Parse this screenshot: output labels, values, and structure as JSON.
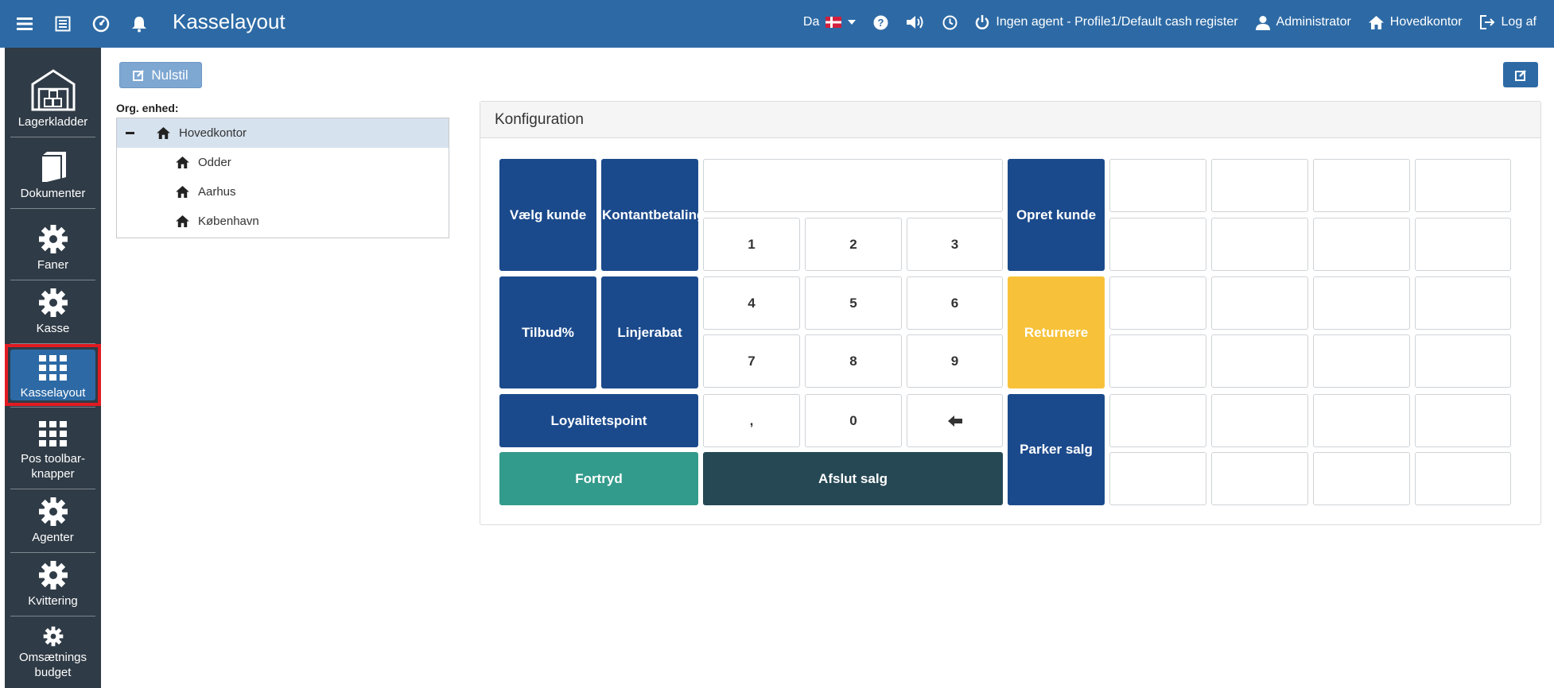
{
  "header": {
    "title": "Kasselayout",
    "language": "Da",
    "agent_label": "Ingen agent - Profile1/Default cash register",
    "user_label": "Administrator",
    "office_label": "Hovedkontor",
    "logout_label": "Log af"
  },
  "sidebar": {
    "items": [
      {
        "label": "Lagerkladder",
        "icon": "warehouse-icon"
      },
      {
        "label": "Dokumenter",
        "icon": "book-icon"
      },
      {
        "label": "Faner",
        "icon": "gear-icon"
      },
      {
        "label": "Kasse",
        "icon": "gear-icon"
      },
      {
        "label": "Kasselayout",
        "icon": "grid-icon",
        "active": true
      },
      {
        "label": "Pos toolbar-knapper",
        "icon": "grid-icon"
      },
      {
        "label": "Agenter",
        "icon": "gear-icon"
      },
      {
        "label": "Kvittering",
        "icon": "gear-icon"
      },
      {
        "label": "Omsætnings budget",
        "icon": "gear-icon"
      }
    ]
  },
  "toolbar": {
    "reset_label": "Nulstil"
  },
  "org": {
    "label": "Org. enhed:",
    "tree": [
      {
        "label": "Hovedkontor",
        "level": 0
      },
      {
        "label": "Odder",
        "level": 1
      },
      {
        "label": "Aarhus",
        "level": 1
      },
      {
        "label": "København",
        "level": 1
      }
    ]
  },
  "config": {
    "title": "Konfiguration",
    "keys": {
      "choose_customer": "Vælg kunde",
      "cash_payment": "Kontantbetaling",
      "create_customer": "Opret kunde",
      "offer_pct": "Tilbud%",
      "line_discount": "Linjerabat",
      "return": "Returnere",
      "loyalty": "Loyalitetspoint",
      "park_sale": "Parker salg",
      "undo": "Fortryd",
      "finish_sale": "Afslut salg",
      "n1": "1",
      "n2": "2",
      "n3": "3",
      "n4": "4",
      "n5": "5",
      "n6": "6",
      "n7": "7",
      "n8": "8",
      "n9": "9",
      "comma": ",",
      "n0": "0"
    },
    "colors": {
      "blue": "#1b4a8c",
      "yellow": "#f7c23a",
      "teal": "#339b8b",
      "dark": "#254854"
    }
  }
}
